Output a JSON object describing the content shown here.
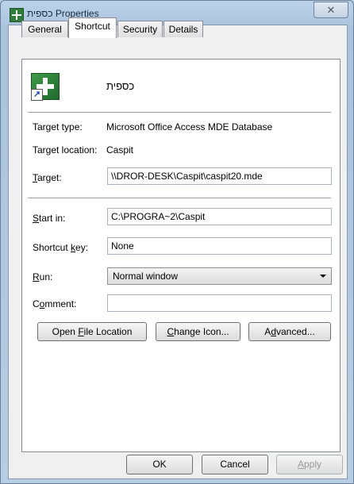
{
  "window": {
    "title": "כספית Properties",
    "close_glyph": "✕"
  },
  "tabs": [
    {
      "label": "General",
      "active": false
    },
    {
      "label": "Shortcut",
      "active": true
    },
    {
      "label": "Security",
      "active": false
    },
    {
      "label": "Details",
      "active": false
    }
  ],
  "shortcut": {
    "name": "כספית"
  },
  "info": {
    "target_type_label": "Target type:",
    "target_type_value": "Microsoft Office Access MDE Database",
    "target_location_label": "Target location:",
    "target_location_value": "Caspit"
  },
  "fields": {
    "target": {
      "label_prefix": "",
      "mnemonic": "T",
      "label_rest": "arget:",
      "value": "\\\\DROR-DESK\\Caspit\\caspit20.mde"
    },
    "start_in": {
      "mnemonic": "S",
      "label_rest": "tart in:",
      "value": "C:\\PROGRA~2\\Caspit"
    },
    "shortcut_key": {
      "label_prefix": "Shortcut ",
      "mnemonic": "k",
      "label_rest": "ey:",
      "value": "None"
    },
    "run": {
      "mnemonic": "R",
      "label_rest": "un:",
      "value": "Normal window"
    },
    "comment": {
      "label_prefix": "C",
      "mnemonic": "o",
      "label_rest": "mment:",
      "value": ""
    }
  },
  "buttons": {
    "open_file_location": {
      "prefix": "Open ",
      "mnemonic": "F",
      "rest": "ile Location"
    },
    "change_icon": {
      "prefix": "",
      "mnemonic": "C",
      "rest": "hange Icon..."
    },
    "advanced": {
      "prefix": "A",
      "mnemonic": "d",
      "rest": "vanced..."
    },
    "ok": "OK",
    "cancel": "Cancel",
    "apply": {
      "prefix": "",
      "mnemonic": "A",
      "rest": "pply"
    }
  },
  "colors": {
    "title_bar": "#bcd3ea",
    "panel": "#ffffff",
    "dialog_bg": "#f0f0f0"
  }
}
